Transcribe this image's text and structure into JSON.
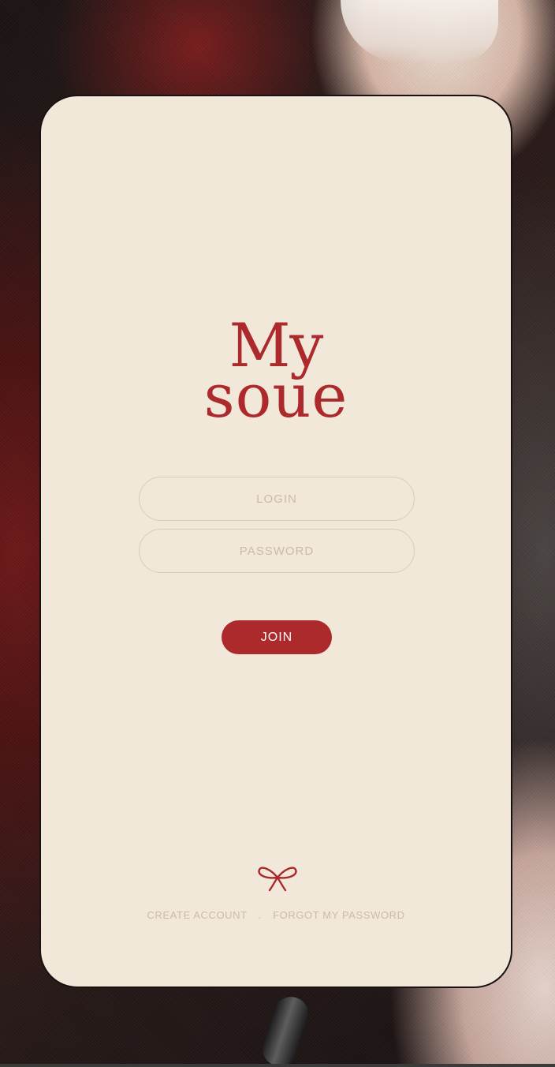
{
  "brand": {
    "line1": "My",
    "line2": "soue"
  },
  "form": {
    "login_placeholder": "LOGIN",
    "password_placeholder": "PASSWORD",
    "join_label": "JOIN"
  },
  "footer": {
    "create_account": "CREATE ACCOUNT",
    "separator": ".",
    "forgot_password": "FORGOT MY PASSWORD",
    "ornament_icon": "bow-icon"
  },
  "colors": {
    "accent": "#ad2a2c",
    "card_background": "#f2e8da",
    "muted_text": "#c8bbab",
    "field_border": "#d8ccbd"
  }
}
